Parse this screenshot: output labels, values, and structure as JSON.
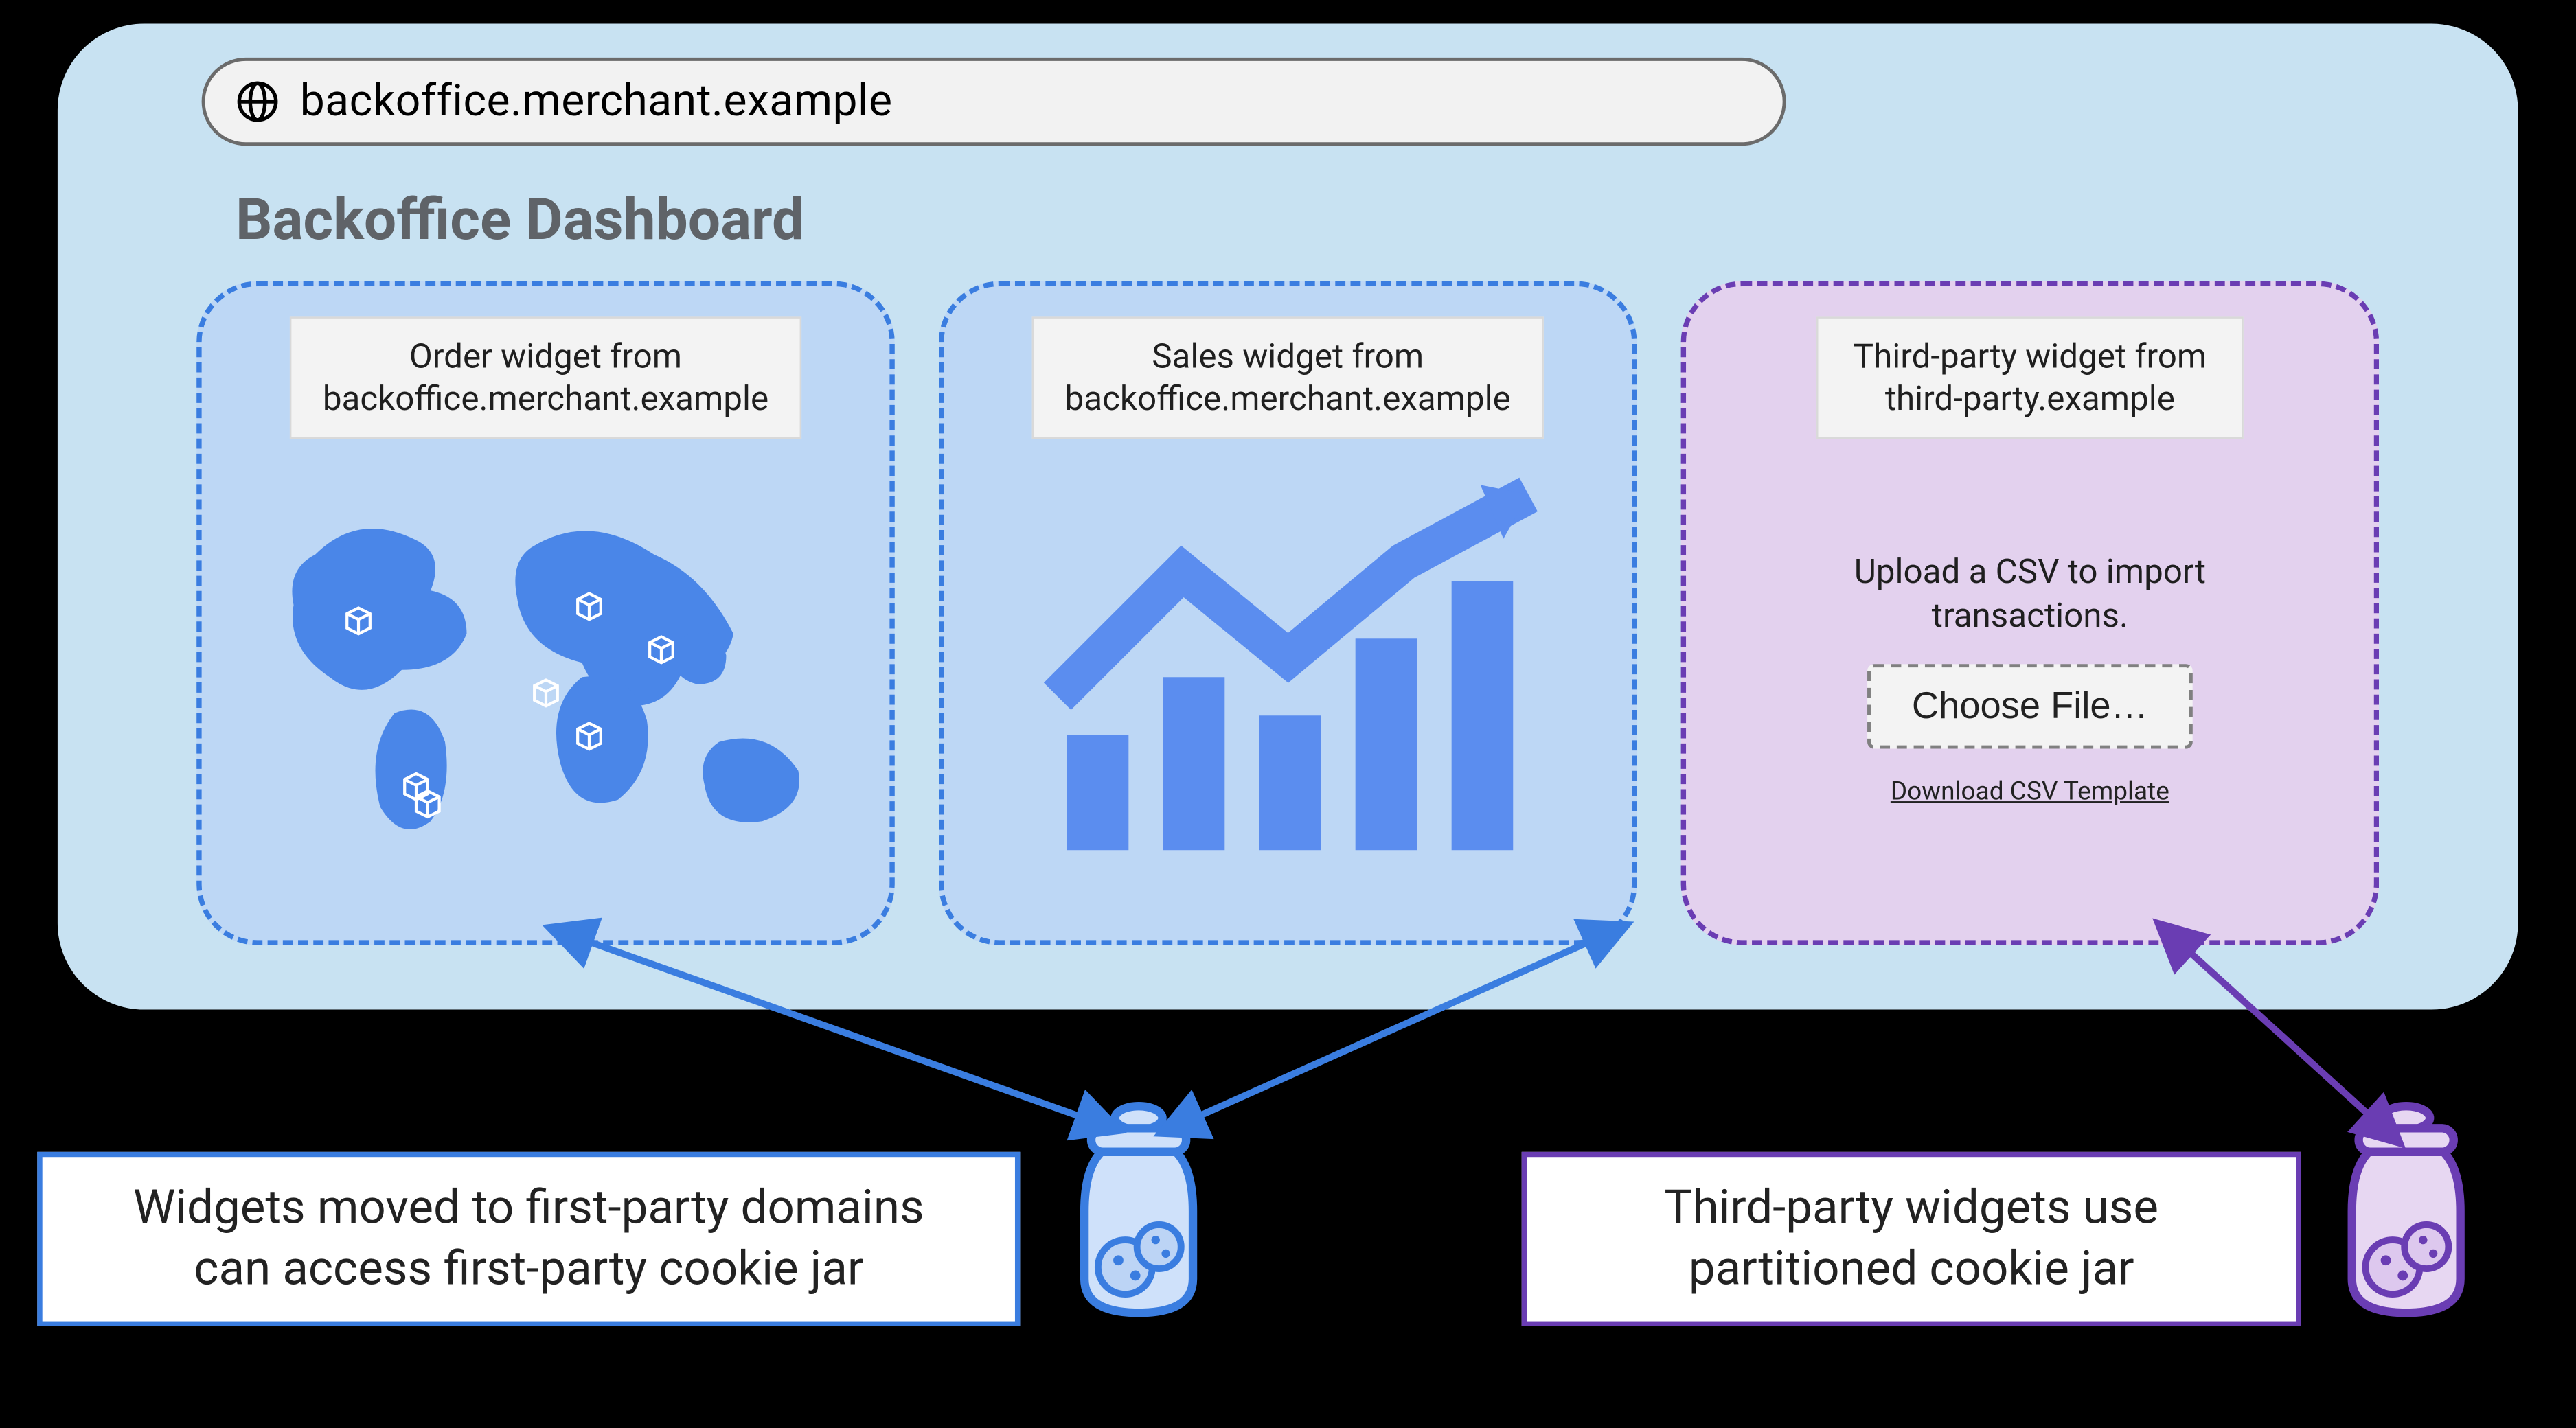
{
  "urlbar": {
    "url": "backoffice.merchant.example"
  },
  "dashboard": {
    "title": "Backoffice Dashboard"
  },
  "widgets": {
    "order": {
      "label": "Order widget from\nbackoffice.merchant.example"
    },
    "sales": {
      "label": "Sales widget from\nbackoffice.merchant.example"
    },
    "thirdparty": {
      "label": "Third-party widget from\nthird-party.example",
      "prompt": "Upload a CSV to import\ntransactions.",
      "choose_file_label": "Choose File…",
      "download_link_label": "Download CSV Template"
    }
  },
  "captions": {
    "first_party": "Widgets moved to first-party domains\ncan access first-party cookie jar",
    "third_party": "Third-party widgets use\npartitioned cookie jar"
  },
  "colors": {
    "blue": "#3a7de0",
    "purple": "#6a3db3",
    "frame_bg": "#c8e2f2",
    "widget_blue_bg": "#bdd7f5",
    "widget_purple_bg": "#e3d1ee"
  }
}
